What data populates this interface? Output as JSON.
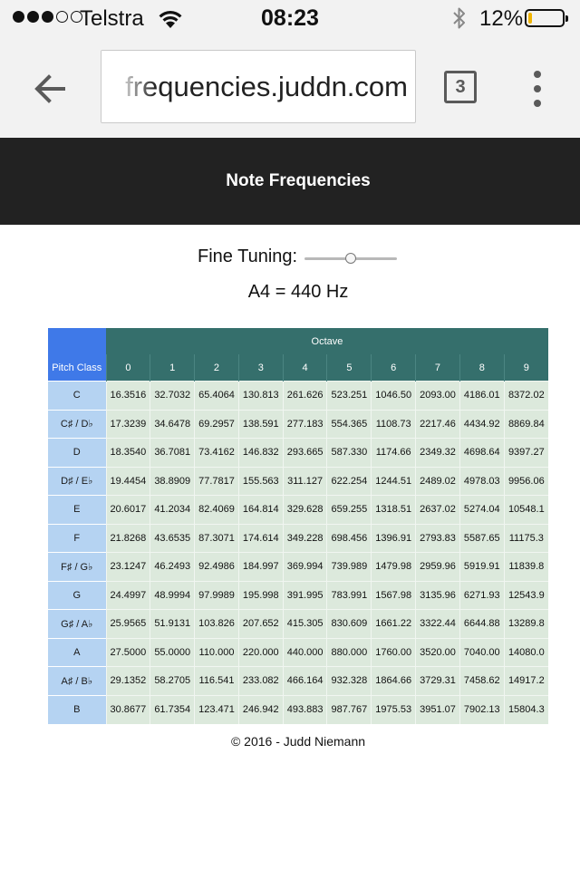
{
  "status_bar": {
    "carrier": "Telstra",
    "time": "08:23",
    "battery_percent": "12%",
    "battery_level": 0.12,
    "signal_bars_filled": 3,
    "signal_bars_total": 5
  },
  "browser": {
    "url": "frequencies.juddn.com",
    "tab_count": "3"
  },
  "page": {
    "title": "Note Frequencies",
    "fine_tuning_label": "Fine Tuning:",
    "fine_tuning_value": 0.5,
    "a4_readout": "A4 = 440 Hz",
    "footer": "© 2016 - Judd Niemann"
  },
  "table": {
    "octave_header": "Octave",
    "pitch_class_header": "Pitch Class",
    "octaves": [
      "0",
      "1",
      "2",
      "3",
      "4",
      "5",
      "6",
      "7",
      "8",
      "9"
    ],
    "rows": [
      {
        "pitch": "C",
        "values": [
          "16.3516",
          "32.7032",
          "65.4064",
          "130.813",
          "261.626",
          "523.251",
          "1046.50",
          "2093.00",
          "4186.01",
          "8372.02"
        ]
      },
      {
        "pitch": "C♯ / D♭",
        "values": [
          "17.3239",
          "34.6478",
          "69.2957",
          "138.591",
          "277.183",
          "554.365",
          "1108.73",
          "2217.46",
          "4434.92",
          "8869.84"
        ]
      },
      {
        "pitch": "D",
        "values": [
          "18.3540",
          "36.7081",
          "73.4162",
          "146.832",
          "293.665",
          "587.330",
          "1174.66",
          "2349.32",
          "4698.64",
          "9397.27"
        ]
      },
      {
        "pitch": "D♯ / E♭",
        "values": [
          "19.4454",
          "38.8909",
          "77.7817",
          "155.563",
          "311.127",
          "622.254",
          "1244.51",
          "2489.02",
          "4978.03",
          "9956.06"
        ]
      },
      {
        "pitch": "E",
        "values": [
          "20.6017",
          "41.2034",
          "82.4069",
          "164.814",
          "329.628",
          "659.255",
          "1318.51",
          "2637.02",
          "5274.04",
          "10548.1"
        ]
      },
      {
        "pitch": "F",
        "values": [
          "21.8268",
          "43.6535",
          "87.3071",
          "174.614",
          "349.228",
          "698.456",
          "1396.91",
          "2793.83",
          "5587.65",
          "11175.3"
        ]
      },
      {
        "pitch": "F♯ / G♭",
        "values": [
          "23.1247",
          "46.2493",
          "92.4986",
          "184.997",
          "369.994",
          "739.989",
          "1479.98",
          "2959.96",
          "5919.91",
          "11839.8"
        ]
      },
      {
        "pitch": "G",
        "values": [
          "24.4997",
          "48.9994",
          "97.9989",
          "195.998",
          "391.995",
          "783.991",
          "1567.98",
          "3135.96",
          "6271.93",
          "12543.9"
        ]
      },
      {
        "pitch": "G♯ / A♭",
        "values": [
          "25.9565",
          "51.9131",
          "103.826",
          "207.652",
          "415.305",
          "830.609",
          "1661.22",
          "3322.44",
          "6644.88",
          "13289.8"
        ]
      },
      {
        "pitch": "A",
        "values": [
          "27.5000",
          "55.0000",
          "110.000",
          "220.000",
          "440.000",
          "880.000",
          "1760.00",
          "3520.00",
          "7040.00",
          "14080.0"
        ]
      },
      {
        "pitch": "A♯ / B♭",
        "values": [
          "29.1352",
          "58.2705",
          "116.541",
          "233.082",
          "466.164",
          "932.328",
          "1864.66",
          "3729.31",
          "7458.62",
          "14917.2"
        ]
      },
      {
        "pitch": "B",
        "values": [
          "30.8677",
          "61.7354",
          "123.471",
          "246.942",
          "493.883",
          "987.767",
          "1975.53",
          "3951.07",
          "7902.13",
          "15804.3"
        ]
      }
    ]
  },
  "colors": {
    "header_bar": "#222222",
    "octave_header": "#356f6c",
    "pitch_header": "#3f79e8",
    "pitch_cell": "#b5d3f2",
    "value_cell": "#dce9dc",
    "battery": "#f0b400"
  },
  "icons": {
    "wifi": "wifi-icon",
    "bluetooth": "bluetooth-icon",
    "battery": "battery-icon",
    "back": "back-arrow-icon",
    "tabs": "tab-switcher-icon",
    "menu": "more-vert-icon"
  }
}
